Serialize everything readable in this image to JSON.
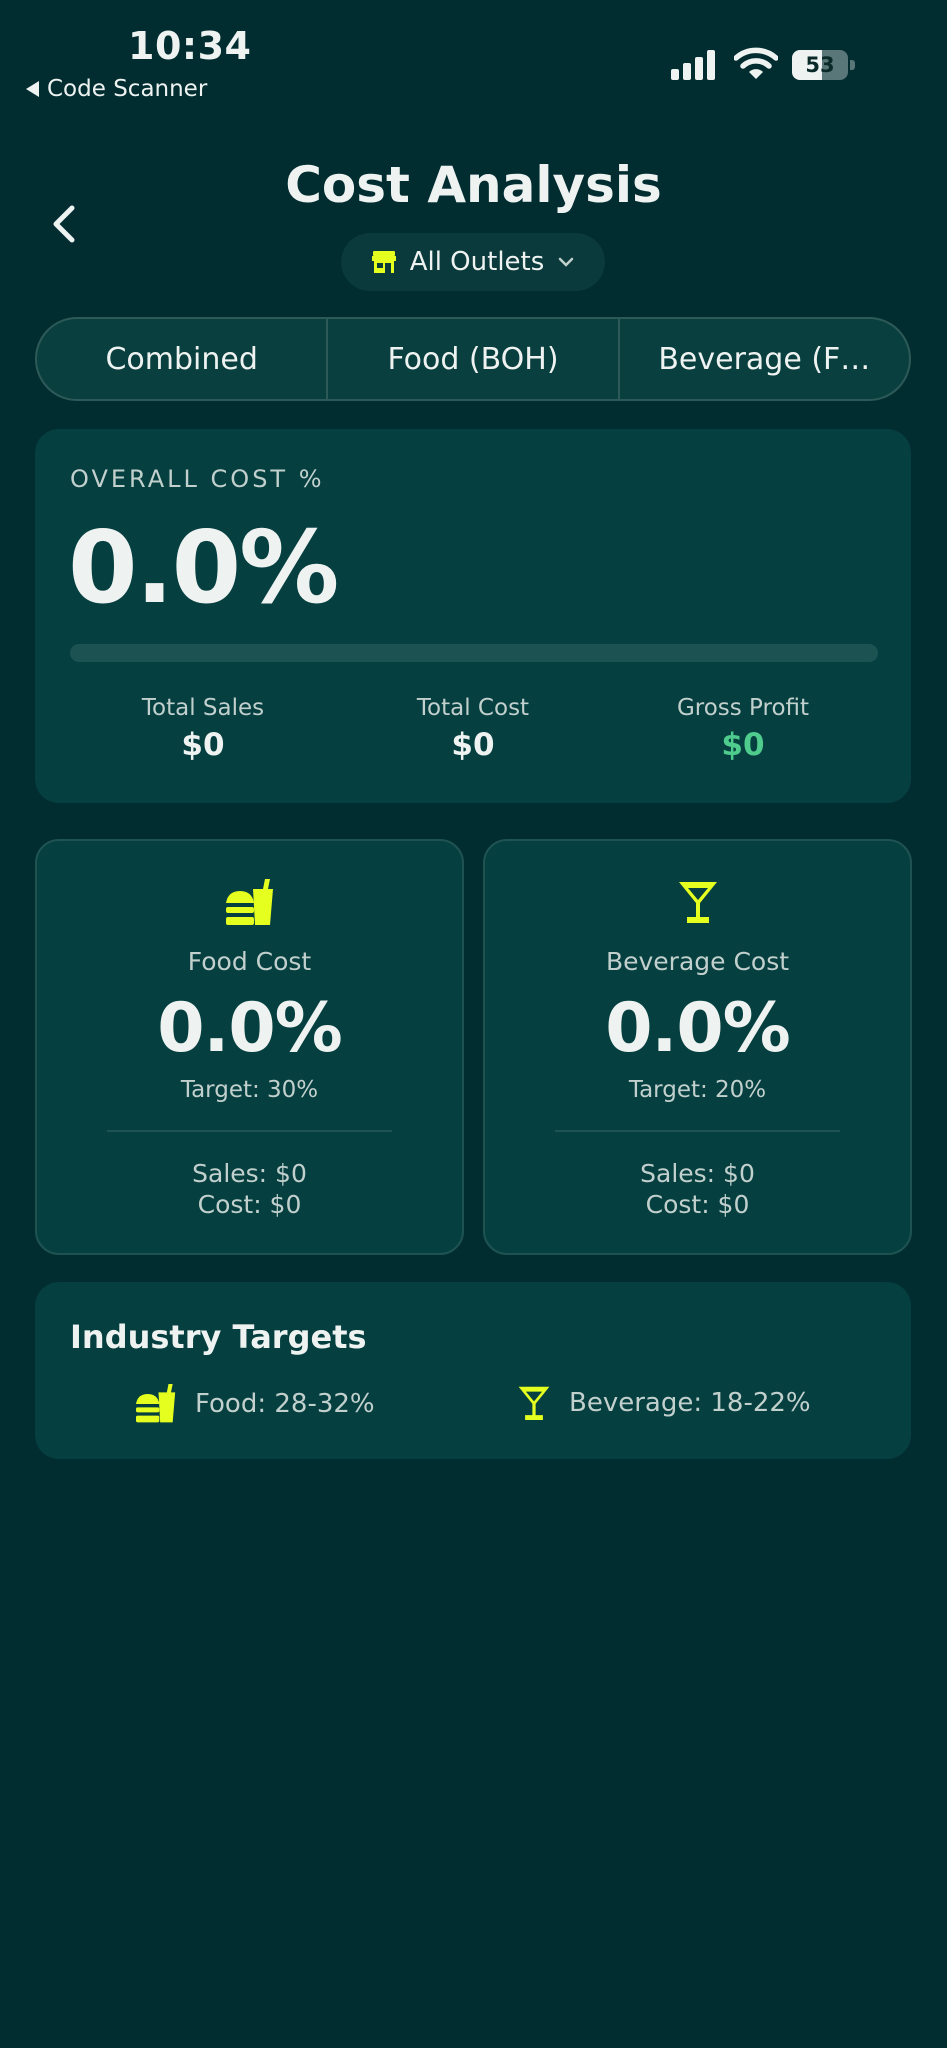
{
  "status_bar": {
    "time": "10:34",
    "back_app": "Code Scanner",
    "battery": "53",
    "battery_level": 0.53
  },
  "header": {
    "title": "Cost Analysis",
    "outlet_selector": "All Outlets"
  },
  "tabs": [
    {
      "label": "Combined",
      "active": true
    },
    {
      "label": "Food (BOH)",
      "active": false
    },
    {
      "label": "Beverage (F…",
      "active": false
    }
  ],
  "overall": {
    "label": "OVERALL COST %",
    "value": "0.0%",
    "progress": 0,
    "stats": [
      {
        "label": "Total Sales",
        "value": "$0"
      },
      {
        "label": "Total Cost",
        "value": "$0"
      },
      {
        "label": "Gross Profit",
        "value": "$0"
      }
    ]
  },
  "food_card": {
    "icon": "fastfood-icon",
    "label": "Food Cost",
    "value": "0.0%",
    "target": "Target: 30%",
    "sales": "Sales: $0",
    "cost": "Cost: $0"
  },
  "beverage_card": {
    "icon": "cocktail-icon",
    "label": "Beverage Cost",
    "value": "0.0%",
    "target": "Target: 20%",
    "sales": "Sales: $0",
    "cost": "Cost: $0"
  },
  "industry_targets": {
    "title": "Industry Targets",
    "food": "Food: 28-32%",
    "beverage": "Beverage: 18-22%"
  },
  "colors": {
    "background": "#012d31",
    "card": "#053f40",
    "accent": "#e5ff1f",
    "profit_green": "#4ecb8d"
  }
}
